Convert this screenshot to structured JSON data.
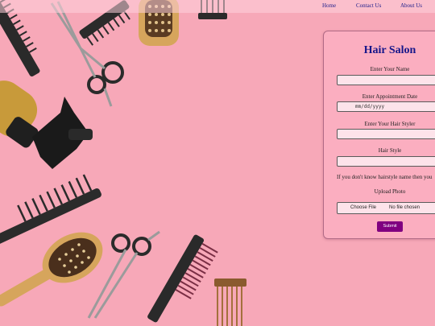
{
  "nav": {
    "home": "Home",
    "contact": "Contact Us",
    "about": "About Us"
  },
  "form": {
    "title": "Hair Salon",
    "name_label": "Enter Your Name",
    "date_label": "Enter Appointment Date",
    "date_placeholder": "mm/dd/yyyy",
    "stylist_label": "Enter Your Hair Styler",
    "style_label": "Hair Style",
    "hint": "If you don't know hairstyle name then you",
    "upload_label": "Upload Photo",
    "file_button": "Choose File",
    "file_status": "No file chosen",
    "submit": "Submit"
  },
  "colors": {
    "background": "#f7a8b8",
    "title": "#16168a",
    "submit": "#800080"
  }
}
